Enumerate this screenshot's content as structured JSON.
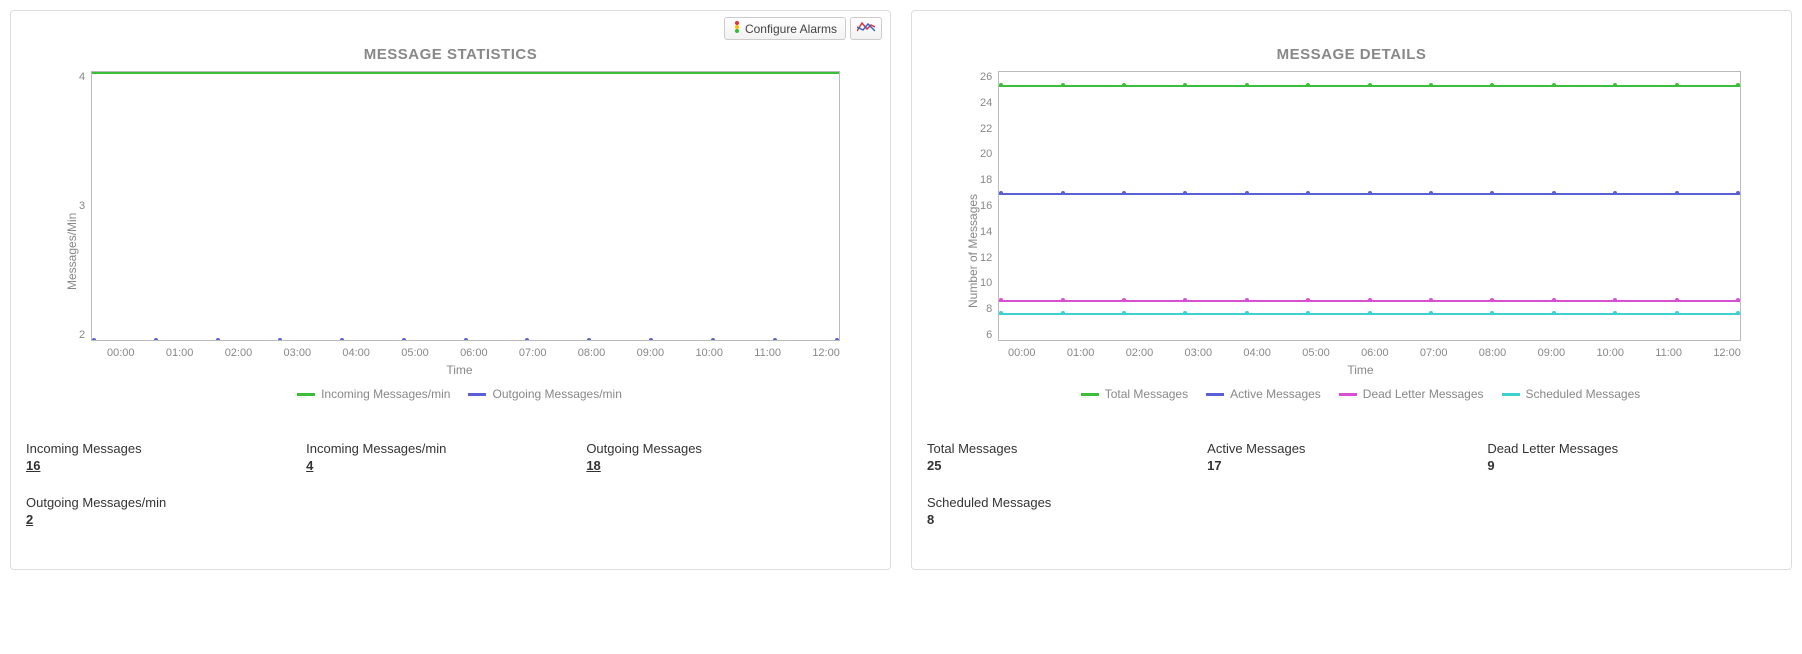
{
  "toolbar": {
    "configure_alarms": "Configure Alarms"
  },
  "left": {
    "title": "MESSAGE STATISTICS",
    "ylabel": "Messages/Min",
    "xlabel": "Time",
    "yticks": [
      "4",
      "3",
      "2"
    ],
    "xticks": [
      "00:00",
      "01:00",
      "02:00",
      "03:00",
      "04:00",
      "05:00",
      "06:00",
      "07:00",
      "08:00",
      "09:00",
      "10:00",
      "11:00",
      "12:00"
    ],
    "legend": [
      {
        "name": "Incoming Messages/min",
        "color": "#3bbf3b"
      },
      {
        "name": "Outgoing Messages/min",
        "color": "#5a5fd6"
      }
    ],
    "stats": [
      {
        "label": "Incoming Messages",
        "value": "16",
        "link": true
      },
      {
        "label": "Incoming Messages/min",
        "value": "4",
        "link": true
      },
      {
        "label": "Outgoing Messages",
        "value": "18",
        "link": true
      },
      {
        "label": "Outgoing Messages/min",
        "value": "2",
        "link": true
      }
    ]
  },
  "right": {
    "title": "MESSAGE DETAILS",
    "ylabel": "Number of Messages",
    "xlabel": "Time",
    "yticks": [
      "26",
      "24",
      "22",
      "20",
      "18",
      "16",
      "14",
      "12",
      "10",
      "8",
      "6"
    ],
    "xticks": [
      "00:00",
      "01:00",
      "02:00",
      "03:00",
      "04:00",
      "05:00",
      "06:00",
      "07:00",
      "08:00",
      "09:00",
      "10:00",
      "11:00",
      "12:00"
    ],
    "legend": [
      {
        "name": "Total Messages",
        "color": "#3bbf3b"
      },
      {
        "name": "Active Messages",
        "color": "#5a5fd6"
      },
      {
        "name": "Dead Letter Messages",
        "color": "#d84fd1"
      },
      {
        "name": "Scheduled Messages",
        "color": "#3fd1cf"
      }
    ],
    "stats": [
      {
        "label": "Total Messages",
        "value": "25",
        "link": false
      },
      {
        "label": "Active Messages",
        "value": "17",
        "link": false
      },
      {
        "label": "Dead Letter Messages",
        "value": "9",
        "link": false
      },
      {
        "label": "Scheduled Messages",
        "value": "8",
        "link": false
      }
    ]
  },
  "chart_data": [
    {
      "type": "line",
      "title": "MESSAGE STATISTICS",
      "xlabel": "Time",
      "ylabel": "Messages/Min",
      "ylim": [
        2,
        4
      ],
      "categories": [
        "00:00",
        "01:00",
        "02:00",
        "03:00",
        "04:00",
        "05:00",
        "06:00",
        "07:00",
        "08:00",
        "09:00",
        "10:00",
        "11:00",
        "12:00"
      ],
      "series": [
        {
          "name": "Incoming Messages/min",
          "color": "#3bbf3b",
          "values": [
            4,
            4,
            4,
            4,
            4,
            4,
            4,
            4,
            4,
            4,
            4,
            4,
            4
          ]
        },
        {
          "name": "Outgoing Messages/min",
          "color": "#5a5fd6",
          "values": [
            2,
            2,
            2,
            2,
            2,
            2,
            2,
            2,
            2,
            2,
            2,
            2,
            2
          ]
        }
      ]
    },
    {
      "type": "line",
      "title": "MESSAGE DETAILS",
      "xlabel": "Time",
      "ylabel": "Number of Messages",
      "ylim": [
        6,
        26
      ],
      "categories": [
        "00:00",
        "01:00",
        "02:00",
        "03:00",
        "04:00",
        "05:00",
        "06:00",
        "07:00",
        "08:00",
        "09:00",
        "10:00",
        "11:00",
        "12:00"
      ],
      "series": [
        {
          "name": "Total Messages",
          "color": "#3bbf3b",
          "values": [
            25,
            25,
            25,
            25,
            25,
            25,
            25,
            25,
            25,
            25,
            25,
            25,
            25
          ]
        },
        {
          "name": "Active Messages",
          "color": "#5a5fd6",
          "values": [
            17,
            17,
            17,
            17,
            17,
            17,
            17,
            17,
            17,
            17,
            17,
            17,
            17
          ]
        },
        {
          "name": "Dead Letter Messages",
          "color": "#d84fd1",
          "values": [
            9,
            9,
            9,
            9,
            9,
            9,
            9,
            9,
            9,
            9,
            9,
            9,
            9
          ]
        },
        {
          "name": "Scheduled Messages",
          "color": "#3fd1cf",
          "values": [
            8,
            8,
            8,
            8,
            8,
            8,
            8,
            8,
            8,
            8,
            8,
            8,
            8
          ]
        }
      ]
    }
  ]
}
